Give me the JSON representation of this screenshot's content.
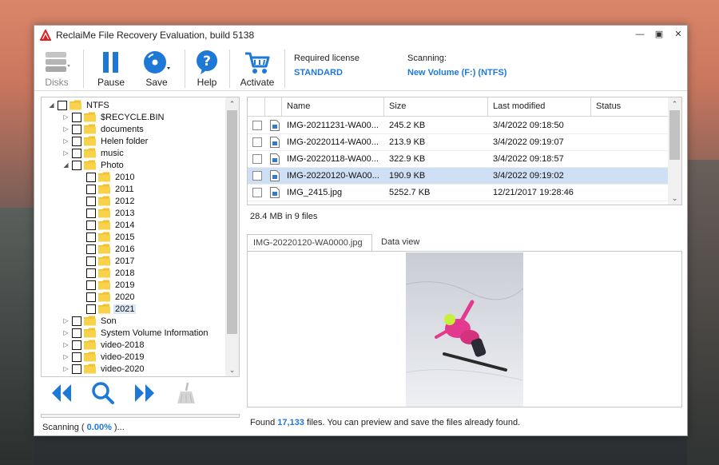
{
  "window": {
    "title": "ReclaiMe File Recovery Evaluation, build 5138"
  },
  "toolbar": {
    "disks_label": "Disks",
    "pause_label": "Pause",
    "save_label": "Save",
    "help_label": "Help",
    "activate_label": "Activate",
    "required_license_label": "Required license",
    "required_license_value": "STANDARD",
    "scanning_label": "Scanning:",
    "scanning_value": "New Volume (F:) (NTFS)"
  },
  "tree": {
    "items": [
      {
        "label": "NTFS",
        "arrow": "◢"
      },
      {
        "label": "$RECYCLE.BIN",
        "arrow": "▷"
      },
      {
        "label": "documents",
        "arrow": "▷"
      },
      {
        "label": "Helen folder",
        "arrow": "▷"
      },
      {
        "label": "music",
        "arrow": "▷"
      },
      {
        "label": "Photo",
        "arrow": "◢"
      },
      {
        "label": "2010",
        "arrow": ""
      },
      {
        "label": "2011",
        "arrow": ""
      },
      {
        "label": "2012",
        "arrow": ""
      },
      {
        "label": "2013",
        "arrow": ""
      },
      {
        "label": "2014",
        "arrow": ""
      },
      {
        "label": "2015",
        "arrow": ""
      },
      {
        "label": "2016",
        "arrow": ""
      },
      {
        "label": "2017",
        "arrow": ""
      },
      {
        "label": "2018",
        "arrow": ""
      },
      {
        "label": "2019",
        "arrow": ""
      },
      {
        "label": "2020",
        "arrow": ""
      },
      {
        "label": "2021",
        "arrow": ""
      },
      {
        "label": "Son",
        "arrow": "▷"
      },
      {
        "label": "System Volume Information",
        "arrow": "▷"
      },
      {
        "label": "video-2018",
        "arrow": "▷"
      },
      {
        "label": "video-2019",
        "arrow": "▷"
      },
      {
        "label": "video-2020",
        "arrow": "▷"
      }
    ]
  },
  "files": {
    "columns": [
      "Name",
      "Size",
      "Last modified",
      "Status"
    ],
    "rows": [
      {
        "name": "IMG-20211231-WA00...",
        "size": "245.2 KB",
        "modified": "3/4/2022 09:18:50",
        "status": ""
      },
      {
        "name": "IMG-20220114-WA00...",
        "size": "213.9 KB",
        "modified": "3/4/2022 09:19:07",
        "status": ""
      },
      {
        "name": "IMG-20220118-WA00...",
        "size": "322.9 KB",
        "modified": "3/4/2022 09:18:57",
        "status": ""
      },
      {
        "name": "IMG-20220120-WA00...",
        "size": "190.9 KB",
        "modified": "3/4/2022 09:19:02",
        "status": ""
      },
      {
        "name": "IMG_2415.jpg",
        "size": "5252.7 KB",
        "modified": "12/21/2017 19:28:46",
        "status": ""
      }
    ],
    "summary": "28.4 MB in 9 files"
  },
  "preview": {
    "tabs": [
      "IMG-20220120-WA0000.jpg",
      "Data view"
    ]
  },
  "status": {
    "scanning_prefix": "Scanning (",
    "scanning_percent": "0.00%",
    "scanning_suffix": ")...",
    "found_prefix": "Found",
    "found_count": "17,133",
    "found_suffix": "files. You can preview and save the files already found."
  },
  "colors": {
    "accent": "#1e78d6",
    "selection": "#cfe0f4",
    "folder": "#f2c32e"
  }
}
